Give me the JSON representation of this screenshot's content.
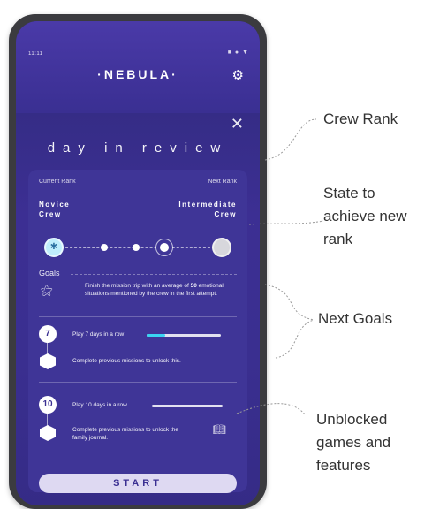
{
  "app": {
    "status_time": "11:11",
    "status_icons": "■ ● ▼",
    "brand": "·NEBULA·",
    "close_glyph": "✕",
    "gear_glyph": "⚙"
  },
  "review": {
    "title": "day in review"
  },
  "rank": {
    "current_label": "Current Rank",
    "next_label": "Next Rank",
    "current_name_line1": "Novice",
    "current_name_line2": "Crew",
    "next_name_line1": "Intermediate",
    "next_name_line2": "Crew"
  },
  "goals": {
    "label": "Goals",
    "mission_text_pre": "Finish the mission trip with an average of ",
    "mission_text_bold": "50",
    "mission_text_post": " emotional situations mentioned by the crew in the first attempt.",
    "goal1_badge": "7",
    "goal1_text": "Play 7 days in a row",
    "goal1_progress": 0.25,
    "goal1_unlock_text": "Complete previous missions to unlock this.",
    "goal2_badge": "10",
    "goal2_text": "Play 10 days in a row",
    "goal2_progress": 0.0,
    "goal2_unlock_text": "Complete previous missions to unlock the family journal."
  },
  "start_label": "START",
  "annotations": {
    "crew_rank": "Crew Rank",
    "state_line1": "State to",
    "state_line2": "achieve  new",
    "state_line3": "rank",
    "next_goals": "Next Goals",
    "unblocked_line1": "Unblocked",
    "unblocked_line2": "games and",
    "unblocked_line3": "features"
  },
  "colors": {
    "accent": "#3ad4f2",
    "card": "#3f3597",
    "background_top": "#4a3aa8"
  }
}
